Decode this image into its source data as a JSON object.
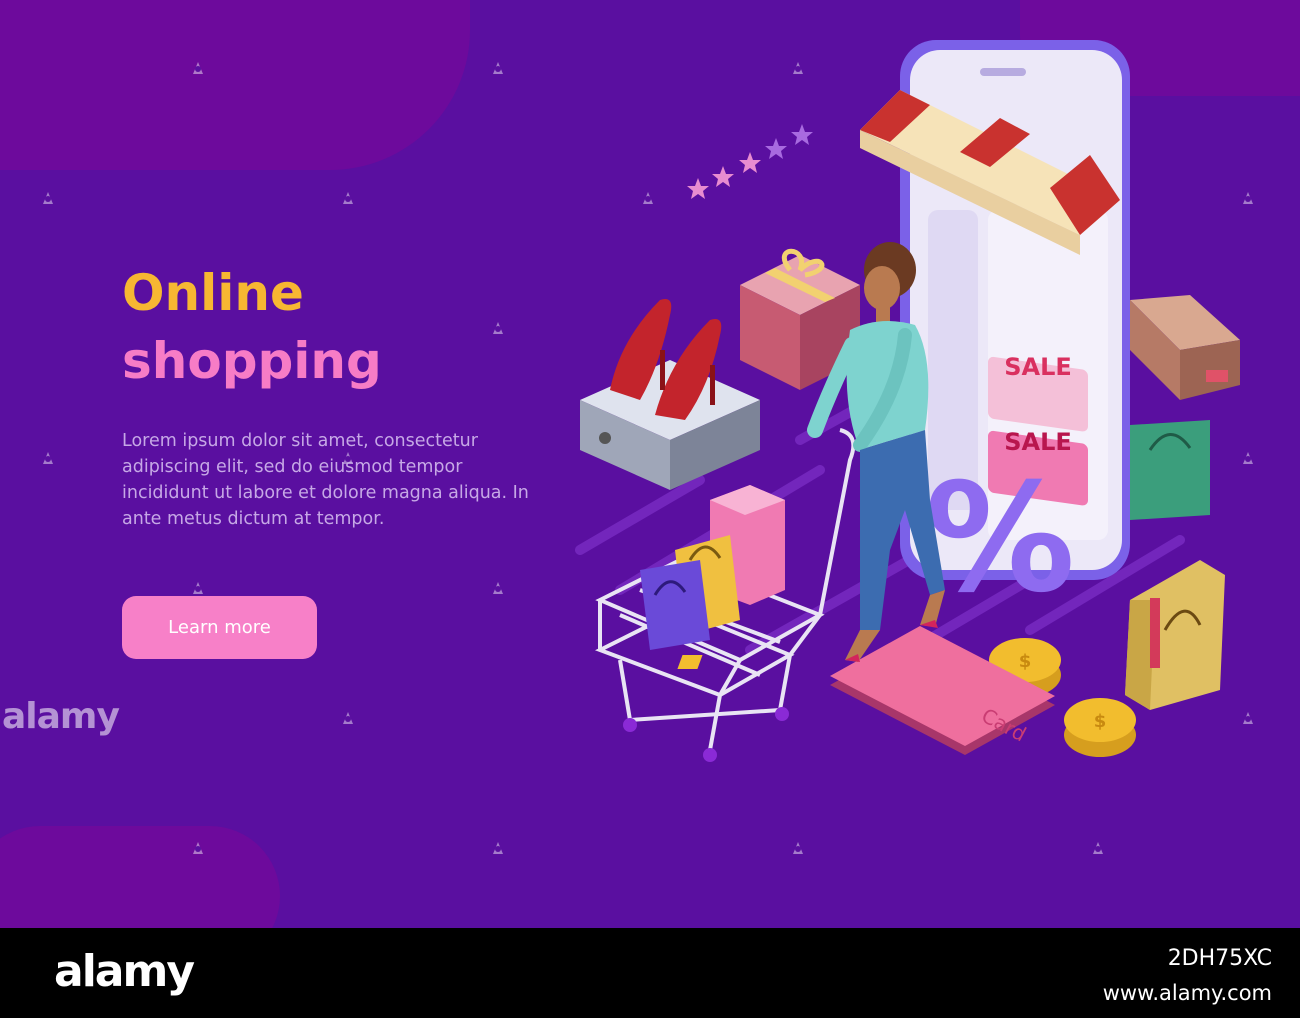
{
  "hero": {
    "title_line1": "Online",
    "title_line2": "shopping",
    "body": "Lorem ipsum dolor sit amet, consectetur adipiscing elit, sed do eiusmod tempor incididunt ut labore et dolore magna aliqua. In ante metus dictum at tempor.",
    "button_label": "Learn more",
    "colors": {
      "background": "#5a0fa0",
      "title_line1": "#f7b732",
      "title_line2": "#f77cc6",
      "button": "#f780c8"
    }
  },
  "illustration": {
    "sale_tag_1": "SALE",
    "sale_tag_2": "SALE",
    "percent_symbol": "%",
    "card_label": "Card",
    "coin_symbol": "$",
    "rating_stars": 5
  },
  "watermark": {
    "text": "alamy"
  },
  "footer": {
    "logo": "alamy",
    "image_id": "2DH75XC",
    "url": "www.alamy.com"
  }
}
